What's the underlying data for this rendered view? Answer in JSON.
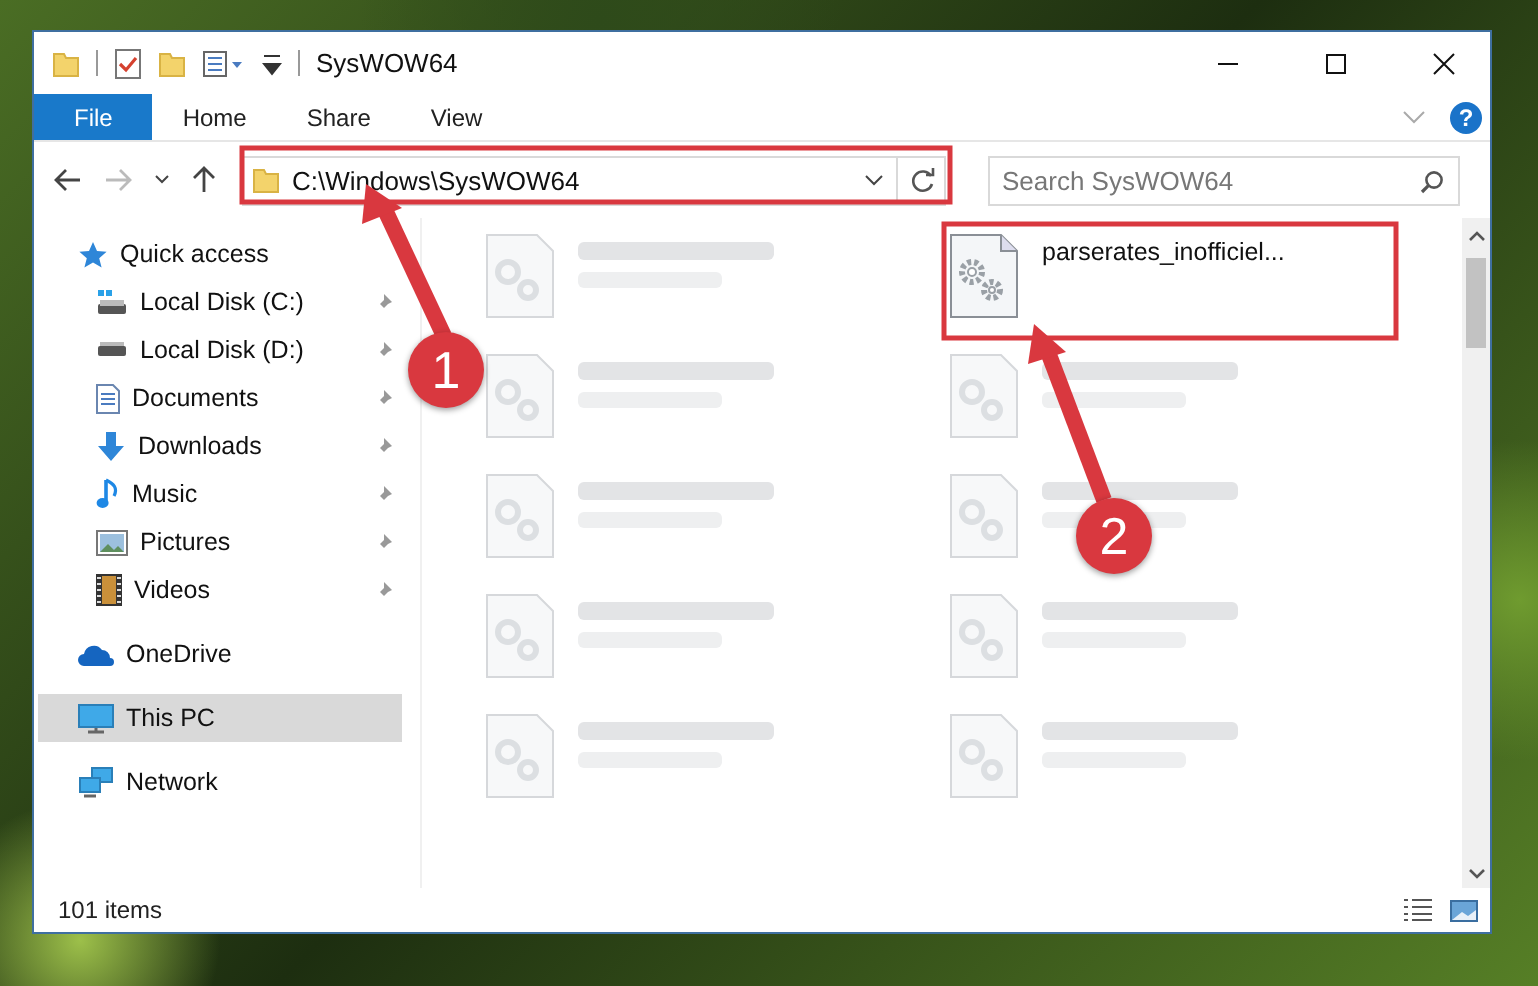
{
  "window": {
    "title": "SysWOW64"
  },
  "ribbon_tabs": [
    {
      "label": "File",
      "selected": true
    },
    {
      "label": "Home",
      "selected": false
    },
    {
      "label": "Share",
      "selected": false
    },
    {
      "label": "View",
      "selected": false
    }
  ],
  "help_button": "?",
  "address": {
    "path": "C:\\Windows\\SysWOW64"
  },
  "search": {
    "placeholder": "Search SysWOW64"
  },
  "sidebar": {
    "items": [
      {
        "label": "Quick access",
        "kind": "star",
        "selected": false,
        "children": [
          {
            "label": "Local Disk (C:)",
            "kind": "system-drive",
            "selected": false,
            "pinned": true
          },
          {
            "label": "Local Disk (D:)",
            "kind": "drive",
            "selected": false,
            "pinned": true
          },
          {
            "label": "Documents",
            "kind": "documents",
            "selected": false,
            "pinned": true
          },
          {
            "label": "Downloads",
            "kind": "downloads",
            "selected": false,
            "pinned": true
          },
          {
            "label": "Music",
            "kind": "music",
            "selected": false,
            "pinned": true
          },
          {
            "label": "Pictures",
            "kind": "pictures",
            "selected": false,
            "pinned": true
          },
          {
            "label": "Videos",
            "kind": "videos",
            "selected": false,
            "pinned": true
          }
        ]
      },
      {
        "label": "OneDrive",
        "kind": "cloud",
        "selected": false
      },
      {
        "label": "This PC",
        "kind": "pc",
        "selected": true
      },
      {
        "label": "Network",
        "kind": "network",
        "selected": false
      }
    ]
  },
  "files": [
    {
      "blurred": true
    },
    {
      "name": "parserates_inofficiel...",
      "blurred": false
    },
    {
      "blurred": true
    },
    {
      "blurred": true
    },
    {
      "blurred": true
    },
    {
      "blurred": true
    },
    {
      "blurred": true
    },
    {
      "blurred": true
    },
    {
      "blurred": true
    },
    {
      "blurred": true
    }
  ],
  "callouts": [
    {
      "number": "1"
    },
    {
      "number": "2"
    }
  ],
  "status_bar": {
    "item_count": "101 items"
  }
}
